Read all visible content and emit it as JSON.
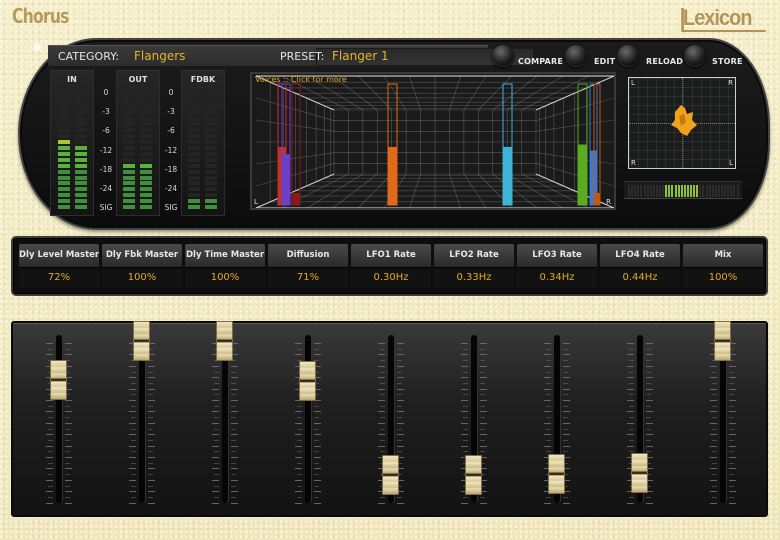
{
  "app": {
    "title": "Chorus",
    "brand": "Lexicon"
  },
  "header": {
    "category_label": "CATEGORY:",
    "category_value": "Flangers",
    "preset_label": "PRESET:",
    "preset_value": "Flanger 1",
    "buttons": [
      {
        "label": "COMPARE"
      },
      {
        "label": "EDIT"
      },
      {
        "label": "RELOAD"
      },
      {
        "label": "STORE"
      }
    ]
  },
  "meters": {
    "in": {
      "label": "IN",
      "left_segments_lit": 12,
      "right_segments_lit": 11
    },
    "out": {
      "label": "OUT",
      "left_segments_lit": 8,
      "right_segments_lit": 8
    },
    "fdbk": {
      "label": "FDBK",
      "left_segments_lit": 2,
      "right_segments_lit": 2
    },
    "scale": [
      "0",
      "-3",
      "-6",
      "-12",
      "-18",
      "-24",
      "SIG"
    ],
    "total_segments": 20
  },
  "voices_display": {
    "label": "Voices :: Click for more",
    "left_label": "L",
    "right_label": "R",
    "voices": [
      {
        "color": "#c03030",
        "level": 0.48
      },
      {
        "color": "#6b3fc8",
        "level": 0.42
      },
      {
        "color": "#8a1a1a",
        "level": 0.1
      },
      {
        "color": "#e06a1a",
        "level": 0.48
      },
      {
        "color": "#3eb3d6",
        "level": 0.48
      },
      {
        "color": "#5aaa22",
        "level": 0.5
      },
      {
        "color": "#3a7ad0",
        "level": 0.45
      },
      {
        "color": "#c05a10",
        "level": 0.1
      }
    ]
  },
  "scope": {
    "corner_labels": [
      "L",
      "R",
      "R",
      "L"
    ]
  },
  "correlation_meter": {
    "lit_from": 0.32,
    "lit_to": 0.62
  },
  "params": [
    {
      "name": "Dly Level Master",
      "value": "72%"
    },
    {
      "name": "Dly Fbk Master",
      "value": "100%"
    },
    {
      "name": "Dly Time Master",
      "value": "100%"
    },
    {
      "name": "Diffusion",
      "value": "71%"
    },
    {
      "name": "LFO1 Rate",
      "value": "0.30Hz"
    },
    {
      "name": "LFO2 Rate",
      "value": "0.33Hz"
    },
    {
      "name": "LFO3 Rate",
      "value": "0.34Hz"
    },
    {
      "name": "LFO4 Rate",
      "value": "0.44Hz"
    },
    {
      "name": "Mix",
      "value": "100%"
    }
  ],
  "faders": [
    {
      "param": "Dly Level Master",
      "position": 0.72
    },
    {
      "param": "Dly Fbk Master",
      "position": 1.0
    },
    {
      "param": "Dly Time Master",
      "position": 1.0
    },
    {
      "param": "Diffusion",
      "position": 0.71
    },
    {
      "param": "LFO1 Rate",
      "position": 0.03
    },
    {
      "param": "LFO2 Rate",
      "position": 0.03
    },
    {
      "param": "LFO3 Rate",
      "position": 0.035
    },
    {
      "param": "LFO4 Rate",
      "position": 0.045
    },
    {
      "param": "Mix",
      "position": 1.0
    }
  ]
}
